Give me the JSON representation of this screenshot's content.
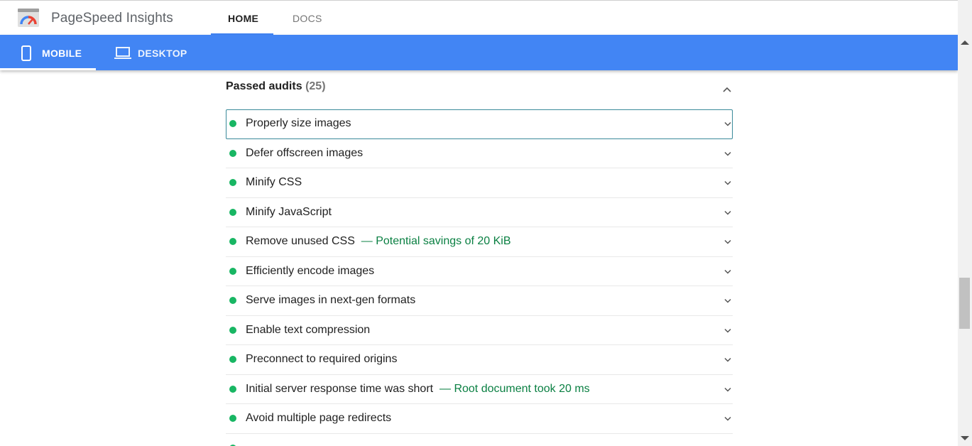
{
  "app": {
    "title": "PageSpeed Insights",
    "nav_tabs": [
      {
        "label": "HOME",
        "active": true
      },
      {
        "label": "DOCS",
        "active": false
      }
    ]
  },
  "device_tabs": [
    {
      "label": "MOBILE",
      "icon": "smartphone-icon",
      "active": true
    },
    {
      "label": "DESKTOP",
      "icon": "laptop-icon",
      "active": false
    }
  ],
  "section": {
    "title": "Passed audits",
    "count": "(25)",
    "expanded": true
  },
  "audits": [
    {
      "title": "Properly size images",
      "savings": "",
      "focused": true
    },
    {
      "title": "Defer offscreen images",
      "savings": ""
    },
    {
      "title": "Minify CSS",
      "savings": ""
    },
    {
      "title": "Minify JavaScript",
      "savings": ""
    },
    {
      "title": "Remove unused CSS",
      "savings": "— Potential savings of 20 KiB"
    },
    {
      "title": "Efficiently encode images",
      "savings": ""
    },
    {
      "title": "Serve images in next-gen formats",
      "savings": ""
    },
    {
      "title": "Enable text compression",
      "savings": ""
    },
    {
      "title": "Preconnect to required origins",
      "savings": ""
    },
    {
      "title": "Initial server response time was short",
      "savings": "— Root document took 20 ms"
    },
    {
      "title": "Avoid multiple page redirects",
      "savings": ""
    }
  ],
  "colors": {
    "accent": "#4285f4",
    "pass": "#18b663",
    "savings": "#0b8043"
  }
}
